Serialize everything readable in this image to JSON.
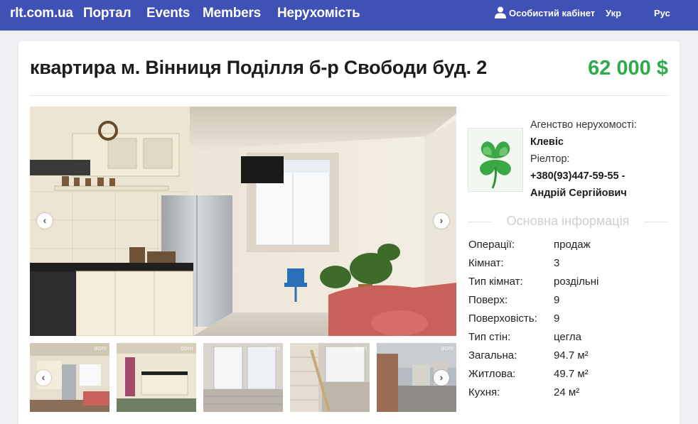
{
  "nav": {
    "brand": "rlt.com.ua",
    "items": [
      "Портал",
      "Events",
      "Members",
      "Нерухомість"
    ],
    "account": "Особистий кабінет",
    "lang_ua": "Укр",
    "lang_ru": "Рус"
  },
  "listing": {
    "title": "квартира м. Вінниця Поділля б-р Свободи буд. 2",
    "price": "62 000 $"
  },
  "gallery": {
    "watermark": "dom"
  },
  "agency": {
    "label": "Агенство нерухомості:",
    "name": "Клевіс",
    "realtor_label": "Ріелтор:",
    "realtor_phone": "+380(93)447-59-55 -",
    "realtor_name": "Андрій Сергійович"
  },
  "info": {
    "section_title": "Основна інформація",
    "rows": [
      {
        "label": "Операції:",
        "value": "продаж"
      },
      {
        "label": "Кімнат:",
        "value": "3"
      },
      {
        "label": "Тип кімнат:",
        "value": "роздільні"
      },
      {
        "label": "Поверх:",
        "value": "9"
      },
      {
        "label": "Поверховість:",
        "value": "9"
      },
      {
        "label": "Тип стін:",
        "value": "цегла"
      },
      {
        "label": "Загальна:",
        "value": "94.7 м²"
      },
      {
        "label": "Житлова:",
        "value": "49.7 м²"
      },
      {
        "label": "Кухня:",
        "value": "24 м²"
      }
    ]
  },
  "colors": {
    "nav_bg": "#3f51b5",
    "price": "#2eaa4a"
  }
}
